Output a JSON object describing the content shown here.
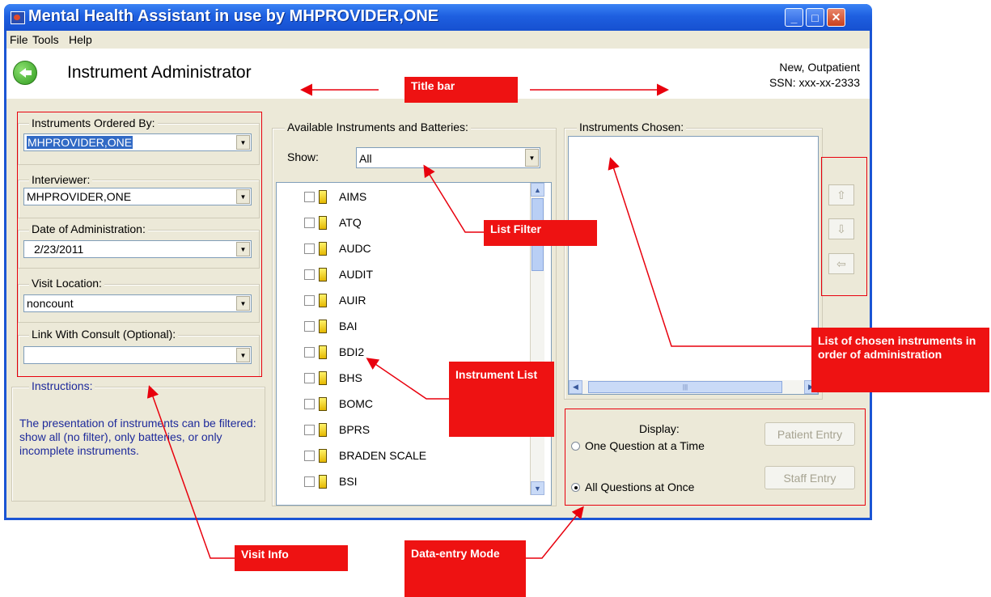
{
  "window": {
    "title": "Mental Health Assistant in use by MHPROVIDER,ONE"
  },
  "menu": [
    "File",
    "Tools",
    "Help"
  ],
  "header": {
    "title": "Instrument Administrator",
    "patient_line1": "New, Outpatient",
    "patient_line2": "SSN: xxx-xx-2333"
  },
  "visit_info": {
    "ordered_by_label": "Instruments Ordered By:",
    "ordered_by_value": "MHPROVIDER,ONE",
    "interviewer_label": "Interviewer:",
    "interviewer_value": "MHPROVIDER,ONE",
    "date_label": "Date of Administration:",
    "date_value": "2/23/2011",
    "location_label": "Visit Location:",
    "location_value": "noncount",
    "consult_label": "Link With Consult (Optional):",
    "consult_value": ""
  },
  "instructions": {
    "label": "Instructions:",
    "text": "The presentation of instruments can be filtered: show all (no filter), only batteries, or only incomplete instruments."
  },
  "available": {
    "label": "Available Instruments and Batteries:",
    "show_label": "Show:",
    "show_value": "All",
    "items": [
      "AIMS",
      "ATQ",
      "AUDC",
      "AUDIT",
      "AUIR",
      "BAI",
      "BDI2",
      "BHS",
      "BOMC",
      "BPRS",
      "BRADEN SCALE",
      "BSI"
    ]
  },
  "chosen": {
    "label": "Instruments Chosen:"
  },
  "display": {
    "label": "Display:",
    "option_one": "One Question at a Time",
    "option_all": "All Questions at Once",
    "selected": "All Questions at Once",
    "patient_entry": "Patient Entry",
    "staff_entry": "Staff Entry"
  },
  "annotations": {
    "title_bar": "Title bar",
    "list_filter": "List Filter",
    "chosen_list": "List of chosen instruments in order of administration",
    "instrument_list": "Instrument List",
    "visit_info": "Visit Info",
    "data_entry_mode": "Data-entry Mode"
  },
  "colors": {
    "annotation_red": "#ee1212",
    "titlebar_blue": "#1e5fe0",
    "instructions_text": "#1e2a9b"
  }
}
